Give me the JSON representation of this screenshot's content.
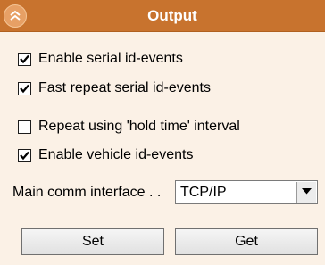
{
  "header": {
    "title": "Output",
    "collapse_icon": "double-chevron-up-icon",
    "color": "#c8732e"
  },
  "options": [
    {
      "label": "Enable serial id-events",
      "checked": true
    },
    {
      "label": "Fast repeat serial id-events",
      "checked": true
    },
    {
      "label": "Repeat using 'hold time' interval",
      "checked": false
    },
    {
      "label": "Enable vehicle id-events",
      "checked": true
    }
  ],
  "interface": {
    "label": "Main comm interface . .",
    "value": "TCP/IP"
  },
  "buttons": {
    "set_label": "Set",
    "get_label": "Get"
  }
}
